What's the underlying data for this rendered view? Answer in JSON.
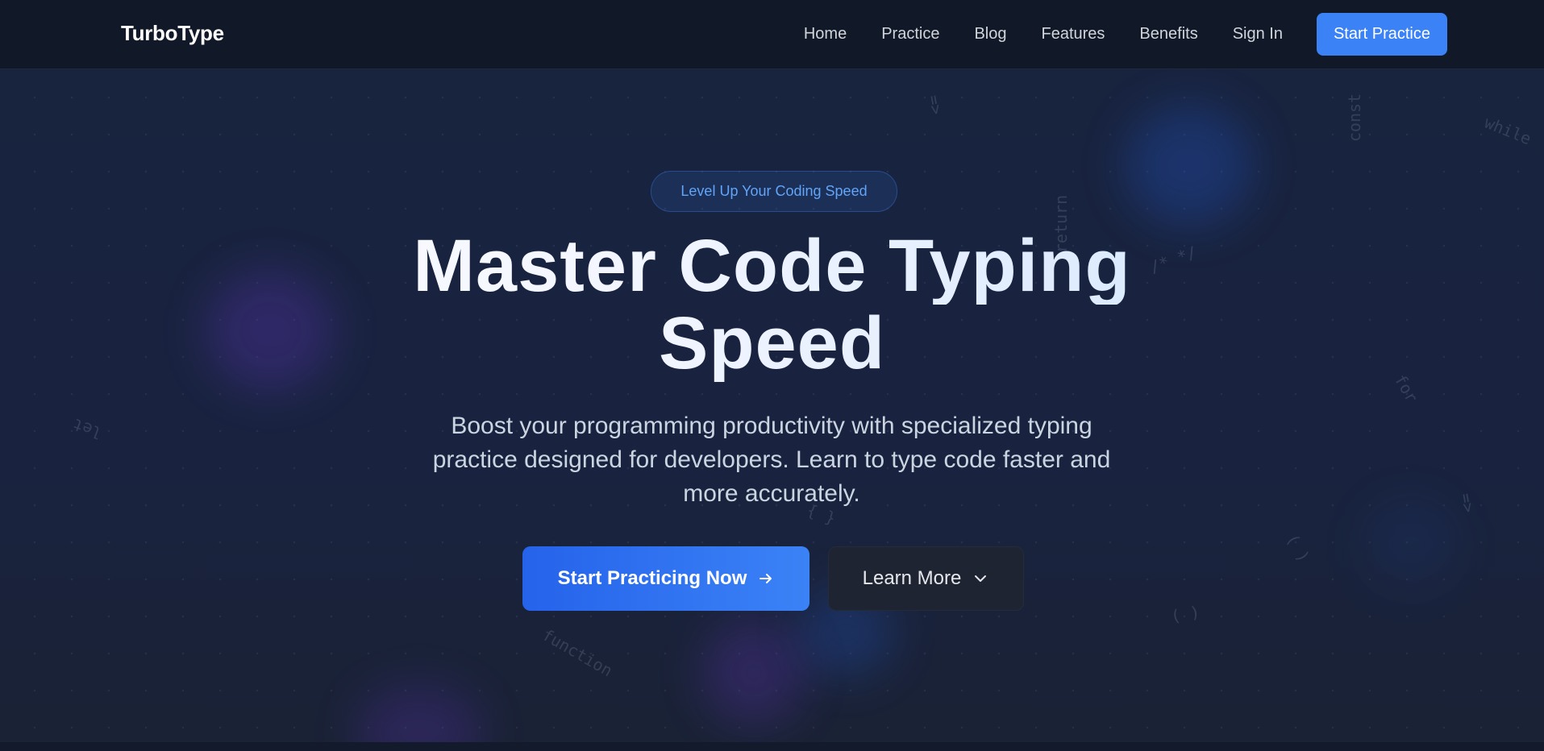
{
  "nav": {
    "brand": "TurboType",
    "links": [
      "Home",
      "Practice",
      "Blog",
      "Features",
      "Benefits",
      "Sign In"
    ],
    "cta": "Start Practice"
  },
  "hero": {
    "badge": "Level Up Your Coding Speed",
    "title_line1": "Master Code Typing",
    "title_line2": "Speed",
    "subtitle": "Boost your programming productivity with specialized typing practice designed for developers. Learn to type code faster and more accurately.",
    "primary_button": "Start Practicing Now",
    "secondary_button": "Learn More"
  },
  "background_tokens": [
    "=>",
    "const",
    "while",
    "return",
    "/* */",
    "let",
    "for",
    "=>",
    "( )",
    "{ }",
    "( )",
    "function",
    "[]"
  ],
  "icons": {
    "primary_button_icon": "arrow-right-icon",
    "secondary_button_icon": "chevron-down-icon"
  },
  "colors": {
    "navbar_bg": "#111827",
    "hero_bg": "#18233e",
    "accent": "#3b82f6",
    "badge_text": "#60a5fa"
  }
}
